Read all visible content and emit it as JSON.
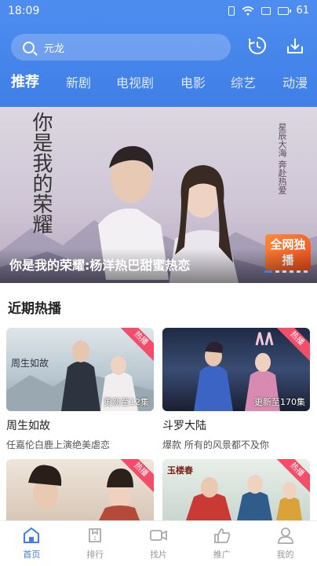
{
  "status_bar": {
    "time": "18:09",
    "battery": "61"
  },
  "search": {
    "placeholder": "元龙"
  },
  "tabs": [
    {
      "label": "推荐",
      "active": true
    },
    {
      "label": "新剧"
    },
    {
      "label": "电视剧"
    },
    {
      "label": "电影"
    },
    {
      "label": "综艺"
    },
    {
      "label": "动漫"
    }
  ],
  "banner": {
    "caption": "你是我的荣耀:杨洋热巴甜蜜热恋",
    "art_title": "你是我的荣耀",
    "art_tagline": "星辰大海 奔赴热爱",
    "badge": "全网独播",
    "slide_count": 6,
    "active_slide": 1
  },
  "section": {
    "title": "近期热播"
  },
  "cards": [
    {
      "title": "周生如故",
      "desc": "任嘉伦白鹿上演绝美虐恋",
      "ribbon": "热播",
      "episode": "更新至12集",
      "art_text": "周生如故"
    },
    {
      "title": "斗罗大陆",
      "desc": "爆款 所有的风景都不及你",
      "ribbon": "热播",
      "episode": "更新至170集"
    },
    {
      "title": "",
      "desc": "",
      "ribbon": "热播",
      "episode": ""
    },
    {
      "title": "",
      "desc": "",
      "ribbon": "热播",
      "episode": "",
      "art_text": "玉楼春"
    }
  ],
  "bottom_nav": [
    {
      "label": "首页",
      "icon": "home-icon",
      "active": true
    },
    {
      "label": "排行",
      "icon": "rank-icon"
    },
    {
      "label": "找片",
      "icon": "video-icon"
    },
    {
      "label": "推广",
      "icon": "thumbs-up-icon"
    },
    {
      "label": "我的",
      "icon": "user-icon"
    }
  ],
  "colors": {
    "accent": "#3f7fe6",
    "ribbon": "#f24e6a"
  }
}
